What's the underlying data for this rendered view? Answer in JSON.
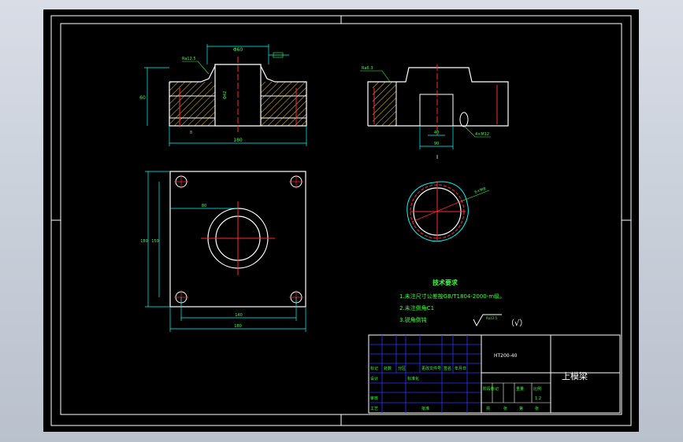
{
  "colors": {
    "background": "#000000",
    "outline": "#ffffff",
    "center_line": "#ff2a2a",
    "dimension": "#00ffff",
    "hatch": "#ffd21e",
    "text": "#3cff3c",
    "table_line": "#2a36ff"
  },
  "top_view": {
    "dim_top": "Φ60",
    "dim_left": "60",
    "dim_bottom": "180",
    "dim_inner": "Φ42",
    "label_leader": "Ra12.5",
    "dim_small": "8"
  },
  "side_view": {
    "dim_bottom": "90",
    "dim_inner": "40",
    "dim_small": "4×M12",
    "label_leader": "Ra6.3"
  },
  "plan_view": {
    "dim_top": "80",
    "dim_left_outer": "180",
    "dim_left_inner": "150",
    "dim_bottom_inner": "140",
    "dim_bottom_outer": "180"
  },
  "detail_view": {
    "label": "I",
    "leader": "6×M8"
  },
  "notes": {
    "title": "技术要求",
    "lines": [
      "1.未注尺寸公差按GB/T1804-2000-m级。",
      "2.未注倒角C1",
      "3.锐角倒钝"
    ]
  },
  "roughness": {
    "value": "Ra12.5",
    "paren": "（√）"
  },
  "title_block": {
    "material": "HT200-40",
    "part_name": "上模梁",
    "row_labels_a": [
      "标记",
      "处数",
      "分区",
      "更改文件号",
      "签名",
      "年月日"
    ],
    "row_labels_b": [
      "设计",
      "标准化",
      "阶段标记",
      "重量",
      "比例"
    ],
    "row_labels_c": [
      "审核",
      "工艺",
      "批准",
      "共",
      "张",
      "第",
      "张"
    ],
    "scale": "1:2"
  }
}
